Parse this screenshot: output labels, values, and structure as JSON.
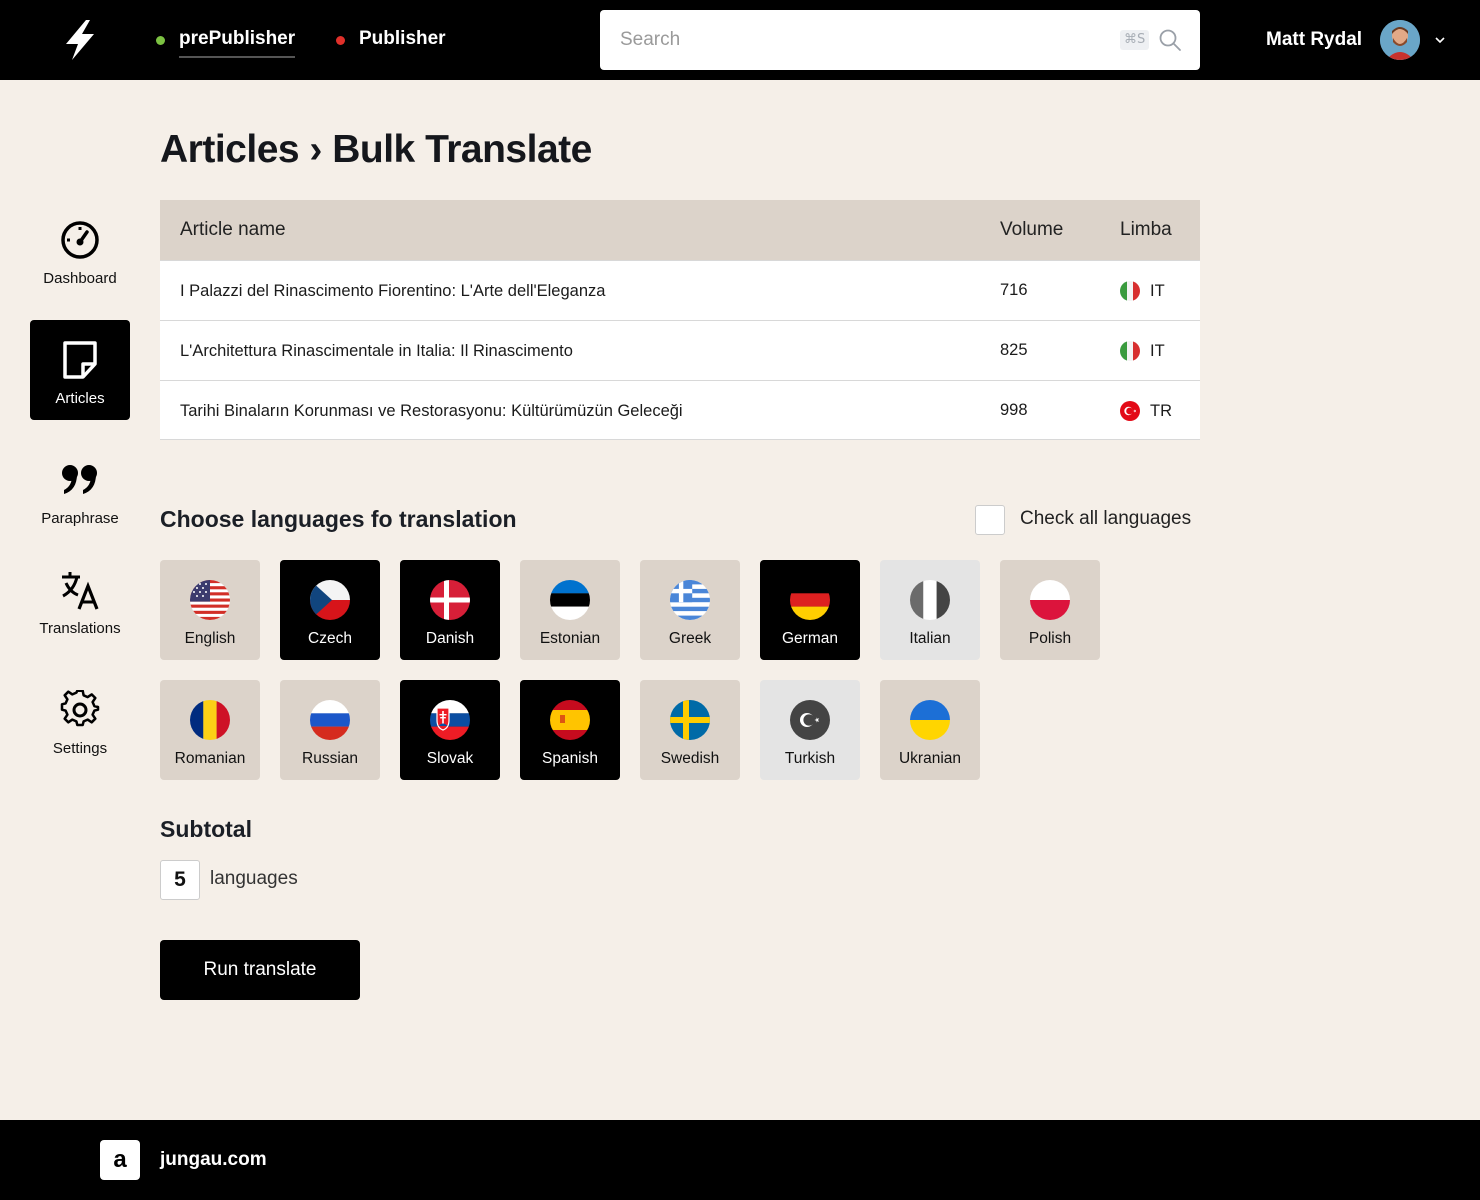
{
  "header": {
    "tabs": [
      {
        "label": "prePublisher",
        "dot_color": "#7cc242",
        "active": true
      },
      {
        "label": "Publisher",
        "dot_color": "#e0302a",
        "active": false
      }
    ],
    "search": {
      "placeholder": "Search",
      "shortcut": "⌘S"
    },
    "user": {
      "name": "Matt Rydal"
    }
  },
  "sidebar": {
    "items": [
      {
        "label": "Dashboard",
        "icon": "gauge-icon"
      },
      {
        "label": "Articles",
        "icon": "document-icon",
        "active": true
      },
      {
        "label": "Paraphrase",
        "icon": "quote-icon"
      },
      {
        "label": "Translations",
        "icon": "translate-icon"
      },
      {
        "label": "Settings",
        "icon": "gear-icon"
      }
    ]
  },
  "page": {
    "title": "Articles › Bulk Translate"
  },
  "table": {
    "columns": [
      "Article name",
      "Volume",
      "Limba"
    ],
    "rows": [
      {
        "name": "I Palazzi del Rinascimento Fiorentino: L'Arte dell'Eleganza",
        "volume": "716",
        "lang": "IT"
      },
      {
        "name": "L'Architettura Rinascimentale in Italia: Il Rinascimento",
        "volume": "825",
        "lang": "IT"
      },
      {
        "name": "Tarihi Binaların Korunması ve Restorasyonu: Kültürümüzün Geleceği",
        "volume": "998",
        "lang": "TR"
      }
    ]
  },
  "languages": {
    "title": "Choose languages fo translation",
    "check_all_label": "Check all languages",
    "items": [
      {
        "label": "English",
        "selected": false
      },
      {
        "label": "Czech",
        "selected": true
      },
      {
        "label": "Danish",
        "selected": true
      },
      {
        "label": "Estonian",
        "selected": false
      },
      {
        "label": "Greek",
        "selected": false
      },
      {
        "label": "German",
        "selected": true
      },
      {
        "label": "Italian",
        "selected": false
      },
      {
        "label": "Polish",
        "selected": false
      },
      {
        "label": "Romanian",
        "selected": false
      },
      {
        "label": "Russian",
        "selected": false
      },
      {
        "label": "Slovak",
        "selected": true
      },
      {
        "label": "Spanish",
        "selected": true
      },
      {
        "label": "Swedish",
        "selected": false
      },
      {
        "label": "Turkish",
        "selected": false
      },
      {
        "label": "Ukranian",
        "selected": false
      }
    ]
  },
  "subtotal": {
    "title": "Subtotal",
    "count": "5",
    "unit": "languages"
  },
  "actions": {
    "run_label": "Run translate"
  },
  "footer": {
    "logo_letter": "a",
    "site": "jungau.com"
  }
}
